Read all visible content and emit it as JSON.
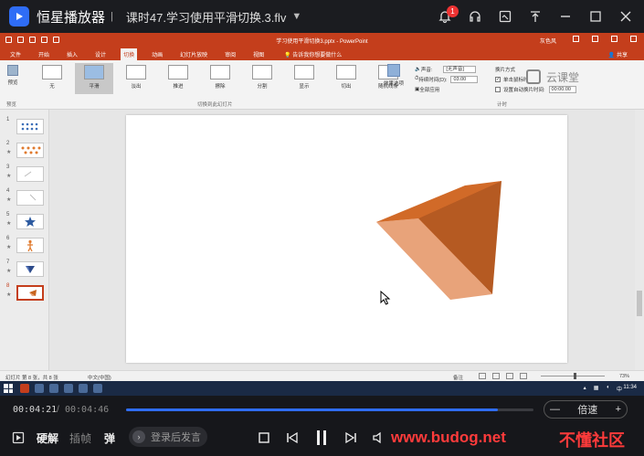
{
  "player": {
    "app_name": "恒星播放器",
    "title_sep": "|",
    "file_title": "课时47.学习使用平滑切换.3.flv",
    "notification_count": "1",
    "accent_color": "#2f6df6"
  },
  "ppt": {
    "doc_title": "学习使用平滑切换3.pptx - PowerPoint",
    "user": "灰色风",
    "tabs": [
      {
        "label": "文件"
      },
      {
        "label": "开始"
      },
      {
        "label": "插入"
      },
      {
        "label": "设计"
      },
      {
        "label": "切换"
      },
      {
        "label": "动画"
      },
      {
        "label": "幻灯片放映"
      },
      {
        "label": "审阅"
      },
      {
        "label": "视图"
      }
    ],
    "active_tab": "切换",
    "tell_me": "告诉我你想要做什么",
    "share": "共享",
    "ribbon": {
      "preview_label": "预览",
      "preview_group": "预览",
      "transitions": [
        {
          "label": "无",
          "selected": false
        },
        {
          "label": "平滑",
          "selected": true
        },
        {
          "label": "淡出",
          "selected": false
        },
        {
          "label": "推进",
          "selected": false
        },
        {
          "label": "擦除",
          "selected": false
        },
        {
          "label": "分割",
          "selected": false
        },
        {
          "label": "显示",
          "selected": false
        },
        {
          "label": "切出",
          "selected": false
        },
        {
          "label": "随机线条",
          "selected": false
        }
      ],
      "effect_options": "效果选项",
      "transitions_group": "切换到此幻灯片",
      "timing_group": "计时",
      "sound_label": "声音:",
      "sound_value": "[无声音]",
      "duration_label": "持续时间(D):",
      "duration_value": "03.00",
      "apply_all": "全部应用",
      "advance_label": "换片方式",
      "on_click": "单击鼠标时",
      "after_label": "设置自动换片时间:",
      "after_value": "00:00.00"
    },
    "watermark_logo": "云课堂",
    "slides": [
      {
        "num": "1",
        "star": ""
      },
      {
        "num": "2",
        "star": "★"
      },
      {
        "num": "3",
        "star": "★"
      },
      {
        "num": "4",
        "star": "★"
      },
      {
        "num": "5",
        "star": "★"
      },
      {
        "num": "6",
        "star": "★"
      },
      {
        "num": "7",
        "star": "★"
      },
      {
        "num": "8",
        "star": "★"
      }
    ],
    "selected_slide": "8",
    "status_left": "幻灯片 第 8 张，共 8 张",
    "status_lang": "中文(中国)",
    "status_notes": "备注",
    "zoom": "73%",
    "taskbar_time": "11:34",
    "shape_colors": {
      "top": "#c8641f",
      "right": "#b55a22",
      "left": "#e8a37a",
      "front": "#ec7a36"
    }
  },
  "controls": {
    "current_time": "00:04:21",
    "time_sep": "/",
    "total_time": "00:04:46",
    "progress": 0.912,
    "speed_label": "倍速",
    "minus": "—",
    "plus": "+",
    "hard_decode": "硬解",
    "frame_interp": "插帧",
    "danmu": "弹",
    "danmu_placeholder": "登录后发言",
    "watermark_url": "www.budog.net",
    "watermark_site": "不懂社区"
  }
}
